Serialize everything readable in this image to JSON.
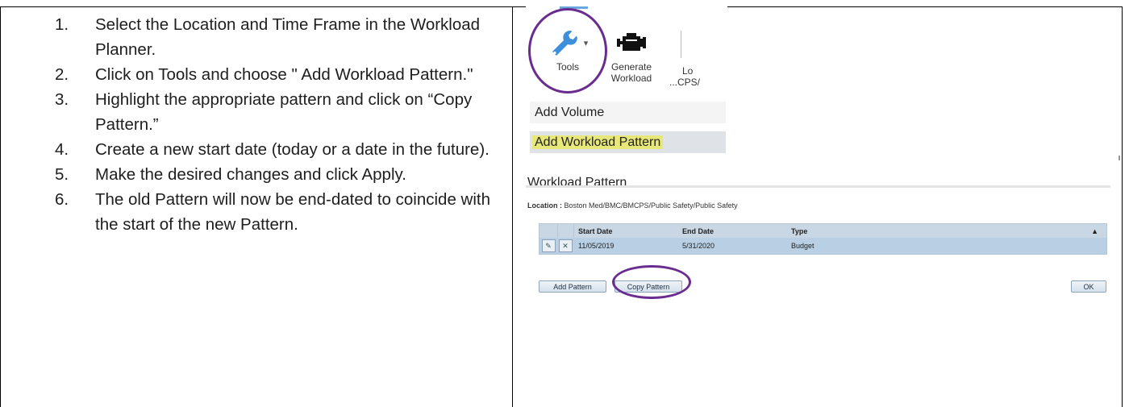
{
  "instructions": [
    {
      "num": "1.",
      "text": "Select the Location and Time Frame in the Workload Planner."
    },
    {
      "num": "2.",
      "text": "Click on Tools and choose \" Add Workload Pattern.\""
    },
    {
      "num": "3.",
      "text": "Highlight the appropriate pattern and click on “Copy Pattern.”"
    },
    {
      "num": "4.",
      "text": "Create a new start date (today or a date in the future)."
    },
    {
      "num": "5.",
      "text": "Make the desired changes and click Apply."
    },
    {
      "num": "6.",
      "text": "The old Pattern will now be end-dated to coincide with the start of the new Pattern."
    }
  ],
  "ribbon": {
    "tools_label": "Tools",
    "tools_dropdown": "▾",
    "generate_label_1": "Generate",
    "generate_label_2": "Workload",
    "lo_label_1": "Lo",
    "lo_label_2": "...CPS/"
  },
  "menu": {
    "items": [
      "Add Volume",
      "Add Workload Pattern"
    ]
  },
  "section_title": "Workload Pattern",
  "location": {
    "label": "Location :",
    "value": "Boston Med/BMC/BMCPS/Public Safety/Public Safety"
  },
  "grid": {
    "headers": {
      "start": "Start Date",
      "end": "End Date",
      "type": "Type",
      "sort": "▲"
    },
    "rows": [
      {
        "edit": "✎",
        "delete": "✕",
        "start": "11/05/2019",
        "end": "5/31/2020",
        "type": "Budget"
      }
    ]
  },
  "buttons": {
    "add": "Add Pattern",
    "copy": "Copy Pattern",
    "ok": "OK"
  },
  "colors": {
    "annotation_circle": "#6a2d8f",
    "highlight": "#e7e77a",
    "grid_row": "#b9cfe4",
    "tools_icon": "#3d8fdc"
  }
}
